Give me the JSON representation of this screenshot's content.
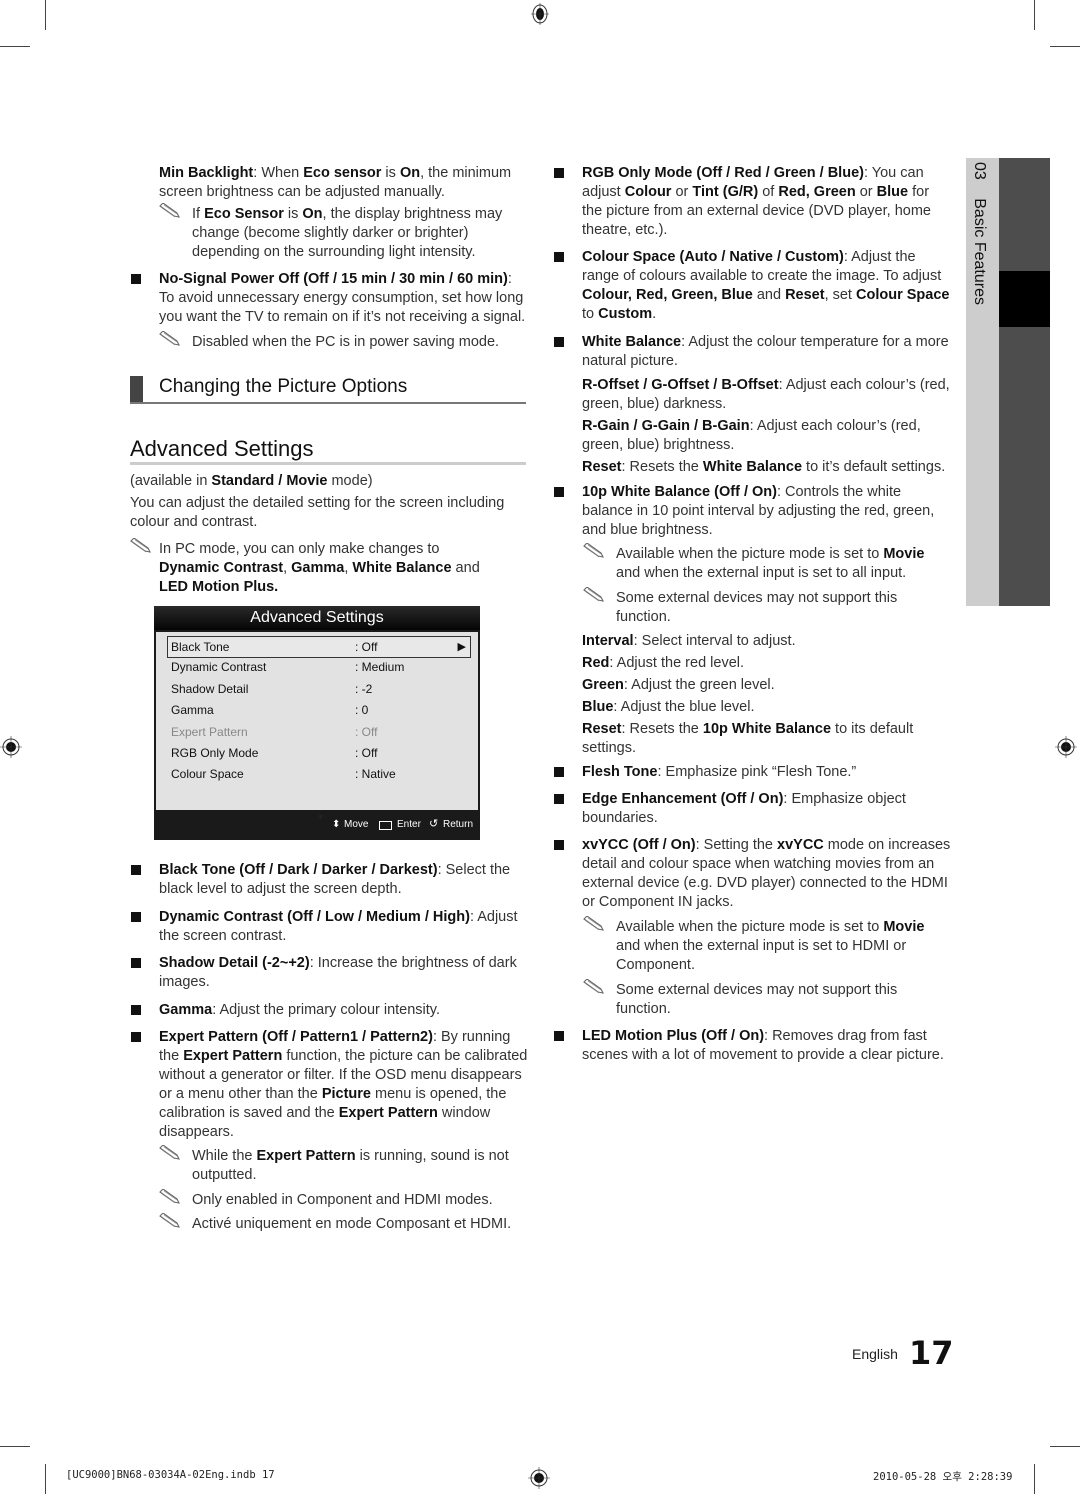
{
  "left_column": {
    "min_backlight": {
      "parts": [
        {
          "t": "Min Backlight",
          "b": true
        },
        {
          "t": ": When ",
          "b": false
        },
        {
          "t": "Eco sensor",
          "b": true
        },
        {
          "t": " is ",
          "b": false
        },
        {
          "t": "On",
          "b": true
        },
        {
          "t": ", the minimum screen brightness can be adjusted manually.",
          "b": false
        }
      ],
      "note": [
        {
          "t": "If ",
          "b": false
        },
        {
          "t": "Eco Sensor",
          "b": true
        },
        {
          "t": " is ",
          "b": false
        },
        {
          "t": "On",
          "b": true
        },
        {
          "t": ", the display brightness may change (become slightly darker or brighter) depending on the surrounding light intensity.",
          "b": false
        }
      ]
    },
    "no_signal": {
      "parts": [
        {
          "t": "No-Signal Power Off (Off / 15 min / 30 min / 60 min)",
          "b": true
        },
        {
          "t": ": To avoid unnecessary energy consumption, set how long you want the TV to remain on if it’s not receiving a signal.",
          "b": false
        }
      ],
      "note": [
        {
          "t": "Disabled when the PC is in power saving mode.",
          "b": false
        }
      ]
    },
    "subsection_title": "Changing the Picture Options",
    "section_title": "Advanced Settings",
    "availability": [
      {
        "t": "(available in ",
        "b": false
      },
      {
        "t": "Standard / Movie",
        "b": true
      },
      {
        "t": " mode)",
        "b": false
      }
    ],
    "intro": "You can adjust the detailed setting for the screen including colour and contrast.",
    "pc_note": [
      {
        "t": "In PC mode, you can only make changes to ",
        "b": false
      },
      {
        "t": "Dynamic Contrast",
        "b": true
      },
      {
        "t": ", ",
        "b": false
      },
      {
        "t": "Gamma",
        "b": true
      },
      {
        "t": ", ",
        "b": false
      },
      {
        "t": "White Balance",
        "b": true
      },
      {
        "t": " and ",
        "b": false
      },
      {
        "t": "LED Motion Plus.",
        "b": true
      }
    ],
    "bullets": [
      {
        "parts": [
          {
            "t": "Black Tone (Off / Dark / Darker / Darkest)",
            "b": true
          },
          {
            "t": ": Select the black level to adjust the screen depth.",
            "b": false
          }
        ]
      },
      {
        "parts": [
          {
            "t": "Dynamic Contrast (Off / Low / Medium / High)",
            "b": true
          },
          {
            "t": ": Adjust the screen contrast.",
            "b": false
          }
        ]
      },
      {
        "parts": [
          {
            "t": "Shadow Detail (-2~+2)",
            "b": true
          },
          {
            "t": ": Increase the brightness of dark images.",
            "b": false
          }
        ]
      },
      {
        "parts": [
          {
            "t": "Gamma",
            "b": true
          },
          {
            "t": ": Adjust the primary colour intensity.",
            "b": false
          }
        ]
      },
      {
        "parts": [
          {
            "t": "Expert Pattern (Off / Pattern1 / Pattern2)",
            "b": true
          },
          {
            "t": ": By running the ",
            "b": false
          },
          {
            "t": "Expert Pattern",
            "b": true
          },
          {
            "t": " function, the picture can be calibrated without a generator or filter. If the OSD menu disappears or a menu other than the ",
            "b": false
          },
          {
            "t": "Picture",
            "b": true
          },
          {
            "t": " menu is opened, the calibration is saved and the ",
            "b": false
          },
          {
            "t": "Expert Pattern",
            "b": true
          },
          {
            "t": " window disappears.",
            "b": false
          }
        ]
      }
    ],
    "expert_notes": [
      [
        {
          "t": "While the ",
          "b": false
        },
        {
          "t": "Expert Pattern",
          "b": true
        },
        {
          "t": " is running, sound is not outputted.",
          "b": false
        }
      ],
      [
        {
          "t": "Only enabled in Component and HDMI modes.",
          "b": false
        }
      ],
      [
        {
          "t": "Activé uniquement en mode Composant et HDMI.",
          "b": false
        }
      ]
    ]
  },
  "osd_menu": {
    "title": "Advanced Settings",
    "rows": [
      {
        "label": "Black Tone",
        "value": ": Off",
        "selected": true,
        "disabled": false
      },
      {
        "label": "Dynamic Contrast",
        "value": ": Medium",
        "selected": false,
        "disabled": false
      },
      {
        "label": "Shadow Detail",
        "value": ": -2",
        "selected": false,
        "disabled": false
      },
      {
        "label": "Gamma",
        "value": ": 0",
        "selected": false,
        "disabled": false
      },
      {
        "label": "Expert Pattern",
        "value": ": Off",
        "selected": false,
        "disabled": true
      },
      {
        "label": "RGB Only Mode",
        "value": ": Off",
        "selected": false,
        "disabled": false
      },
      {
        "label": "Colour Space",
        "value": ": Native",
        "selected": false,
        "disabled": false
      }
    ],
    "arrow_right": "▶",
    "more_indicator": "▼",
    "footer": {
      "move": "Move",
      "enter": "Enter",
      "return": "Return"
    }
  },
  "right_column": {
    "blocks": [
      {
        "bullet": true,
        "parts": [
          {
            "t": "RGB Only Mode (Off / Red / Green / Blue)",
            "b": true
          },
          {
            "t": ": You can adjust ",
            "b": false
          },
          {
            "t": "Colour",
            "b": true
          },
          {
            "t": " or ",
            "b": false
          },
          {
            "t": "Tint (G/R)",
            "b": true
          },
          {
            "t": " of ",
            "b": false
          },
          {
            "t": "Red, Green",
            "b": true
          },
          {
            "t": " or ",
            "b": false
          },
          {
            "t": "Blue",
            "b": true
          },
          {
            "t": " for the picture from an external device (DVD player, home theatre, etc.).",
            "b": false
          }
        ]
      },
      {
        "bullet": true,
        "parts": [
          {
            "t": "Colour Space (Auto / Native / Custom)",
            "b": true
          },
          {
            "t": ": Adjust the range of colours available to create the image. To adjust ",
            "b": false
          },
          {
            "t": "Colour, Red, Green, Blue",
            "b": true
          },
          {
            "t": " and ",
            "b": false
          },
          {
            "t": "Reset",
            "b": true
          },
          {
            "t": ", set ",
            "b": false
          },
          {
            "t": "Colour Space",
            "b": true
          },
          {
            "t": " to ",
            "b": false
          },
          {
            "t": "Custom",
            "b": true
          },
          {
            "t": ".",
            "b": false
          }
        ]
      },
      {
        "bullet": true,
        "parts": [
          {
            "t": "White Balance",
            "b": true
          },
          {
            "t": ": Adjust the colour temperature for a more natural picture.",
            "b": false
          }
        ]
      },
      {
        "bullet": false,
        "parts": [
          {
            "t": "R-Offset / G-Offset / B-Offset",
            "b": true
          },
          {
            "t": ": Adjust each colour’s (red, green, blue) darkness.",
            "b": false
          }
        ]
      },
      {
        "bullet": false,
        "parts": [
          {
            "t": "R-Gain / G-Gain / B-Gain",
            "b": true
          },
          {
            "t": ": Adjust each colour’s (red, green, blue) brightness.",
            "b": false
          }
        ]
      },
      {
        "bullet": false,
        "parts": [
          {
            "t": "Reset",
            "b": true
          },
          {
            "t": ": Resets the ",
            "b": false
          },
          {
            "t": "White Balance",
            "b": true
          },
          {
            "t": " to it’s default settings.",
            "b": false
          }
        ]
      },
      {
        "bullet": true,
        "parts": [
          {
            "t": "10p White Balance (Off / On)",
            "b": true
          },
          {
            "t": ": Controls the white balance in 10 point interval by adjusting the red, green, and blue brightness.",
            "b": false
          }
        ]
      },
      {
        "note": true,
        "parts": [
          {
            "t": "Available when the picture mode is set to ",
            "b": false
          },
          {
            "t": "Movie",
            "b": true
          },
          {
            "t": " and when the external input is set to all input.",
            "b": false
          }
        ]
      },
      {
        "note": true,
        "parts": [
          {
            "t": "Some external devices may not support this function.",
            "b": false
          }
        ]
      },
      {
        "bullet": false,
        "parts": [
          {
            "t": "Interval",
            "b": true
          },
          {
            "t": ": Select interval to adjust.",
            "b": false
          }
        ]
      },
      {
        "bullet": false,
        "parts": [
          {
            "t": "Red",
            "b": true
          },
          {
            "t": ": Adjust the red level.",
            "b": false
          }
        ]
      },
      {
        "bullet": false,
        "parts": [
          {
            "t": "Green",
            "b": true
          },
          {
            "t": ": Adjust the green level.",
            "b": false
          }
        ]
      },
      {
        "bullet": false,
        "parts": [
          {
            "t": "Blue",
            "b": true
          },
          {
            "t": ": Adjust the blue level.",
            "b": false
          }
        ]
      },
      {
        "bullet": false,
        "parts": [
          {
            "t": "Reset",
            "b": true
          },
          {
            "t": ": Resets the ",
            "b": false
          },
          {
            "t": "10p White Balance",
            "b": true
          },
          {
            "t": " to its default settings.",
            "b": false
          }
        ]
      },
      {
        "bullet": true,
        "parts": [
          {
            "t": "Flesh Tone",
            "b": true
          },
          {
            "t": ": Emphasize pink “Flesh Tone.”",
            "b": false
          }
        ]
      },
      {
        "bullet": true,
        "parts": [
          {
            "t": "Edge Enhancement (Off / On)",
            "b": true
          },
          {
            "t": ": Emphasize object boundaries.",
            "b": false
          }
        ]
      },
      {
        "bullet": true,
        "parts": [
          {
            "t": "xvYCC (Off / On)",
            "b": true
          },
          {
            "t": ": Setting the ",
            "b": false
          },
          {
            "t": "xvYCC",
            "b": true
          },
          {
            "t": " mode on increases detail and colour space when watching movies from an external device (e.g. DVD player) connected to the HDMI or Component IN jacks.",
            "b": false
          }
        ]
      },
      {
        "note": true,
        "parts": [
          {
            "t": "Available when the picture mode is set to ",
            "b": false
          },
          {
            "t": "Movie",
            "b": true
          },
          {
            "t": " and when the external input is set to HDMI or Component.",
            "b": false
          }
        ]
      },
      {
        "note": true,
        "parts": [
          {
            "t": "Some external devices may not support this function.",
            "b": false
          }
        ]
      },
      {
        "bullet": true,
        "parts": [
          {
            "t": "LED Motion Plus (Off / On)",
            "b": true
          },
          {
            "t": ": Removes drag from fast scenes with a lot of movement to provide a clear picture.",
            "b": false
          }
        ]
      }
    ]
  },
  "side_tab": {
    "chapter": "03",
    "title": "Basic Features"
  },
  "footer": {
    "language": "English",
    "page_number": "17"
  },
  "print_info": {
    "file": "[UC9000]BN68-03034A-02Eng.indb   17",
    "timestamp": "2010-05-28   오후 2:28:39"
  }
}
